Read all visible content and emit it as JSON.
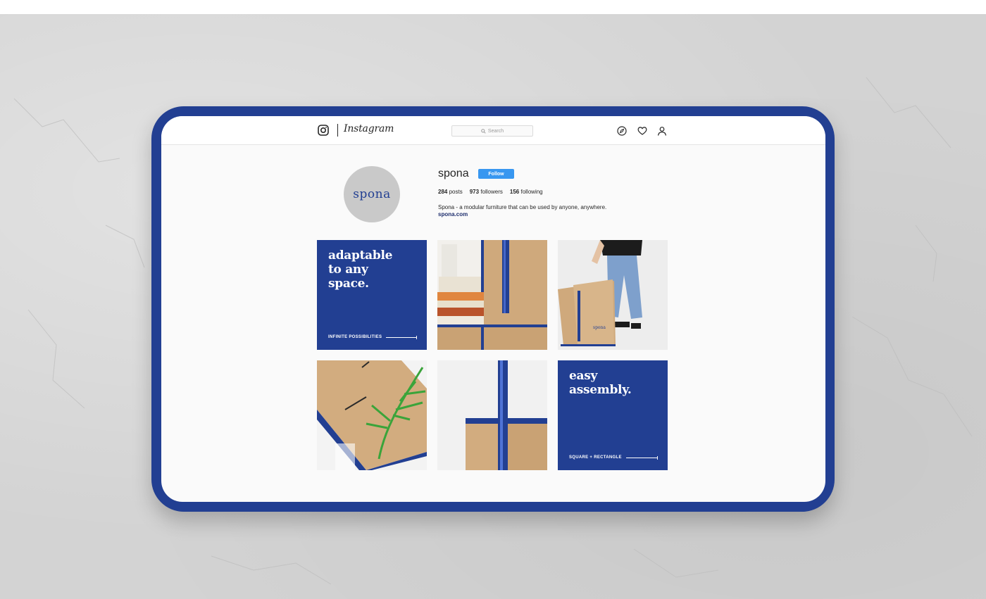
{
  "colors": {
    "brand_blue": "#223f92",
    "follow_blue": "#3897f0",
    "cardboard": "#cfa97c",
    "wall": "#d3d3d3"
  },
  "topbar": {
    "logo_icon": "instagram-camera-icon",
    "wordmark": "Instagram",
    "search_placeholder": "Search",
    "icons": [
      "compass-icon",
      "heart-icon",
      "user-icon"
    ]
  },
  "profile": {
    "avatar_logo": "spona",
    "username": "spona",
    "follow_label": "Follow",
    "posts_count": "284",
    "posts_label": "posts",
    "followers_count": "973",
    "followers_label": "followers",
    "following_count": "156",
    "following_label": "following",
    "bio": "Spona - a modular furniture that can be used by anyone, anywhere.",
    "website": "spona.com"
  },
  "posts": [
    {
      "kind": "text",
      "headline_lines": [
        "adaptable",
        "to any",
        "space."
      ],
      "footer": "INFINITE POSSIBILITIES"
    },
    {
      "kind": "photo",
      "subject": "cardboard-shelf-with-books"
    },
    {
      "kind": "photo",
      "subject": "person-assembling-stool",
      "stamp": "spona"
    },
    {
      "kind": "photo",
      "subject": "cardboard-pieces-with-plant"
    },
    {
      "kind": "photo",
      "subject": "cardboard-joint-closeup"
    },
    {
      "kind": "text",
      "headline_lines": [
        "easy",
        "assembly."
      ],
      "footer": "SQUARE + RECTANGLE"
    }
  ]
}
